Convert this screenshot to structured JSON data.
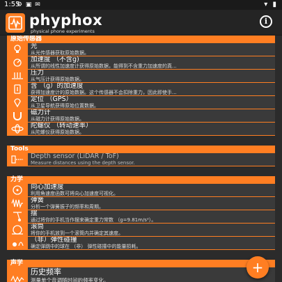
{
  "status": {
    "time": "1:55"
  },
  "header": {
    "app_name": "phyphox",
    "tagline": "physical phone experiments"
  },
  "sections": [
    {
      "title": "原始传感器",
      "items": [
        {
          "title": "光",
          "desc": "从光传感器获取原始数据。",
          "icon": "light-bulb-icon"
        },
        {
          "title": "加速度 （不含g)",
          "desc": "从所谓的线性加速度计获得原始数据，能得到不含重力加速度的真...",
          "icon": "acceleration-icon"
        },
        {
          "title": "压力",
          "desc": "从气压计获得原始数据。",
          "icon": "pressure-icon"
        },
        {
          "title": "含 （g）的加速度",
          "desc": "获得加速度计的原始数据。这个传感器不会扣除重力，因此即使手...",
          "icon": "gravity-acceleration-icon"
        },
        {
          "title": "定位 （GPS）",
          "desc": "从卫星导航获得原始位置数据。",
          "icon": "location-pin-icon"
        },
        {
          "title": "磁力计",
          "desc": "从磁力计获得原始数据。",
          "icon": "magnet-icon"
        },
        {
          "title": "陀螺仪 （转动速率）",
          "desc": "从陀螺仪获得原始数据。",
          "icon": "gyroscope-icon"
        }
      ]
    },
    {
      "title": "Tools",
      "items": [
        {
          "title": "Depth sensor (LiDAR / ToF)",
          "desc": "Measure distances using the depth sensor.",
          "icon": "depth-sensor-icon",
          "disabled": true
        }
      ]
    },
    {
      "title": "力学",
      "items": [
        {
          "title": "向心加速度",
          "desc": "利用角速度函数可将向心加速度可视化。",
          "icon": "centripetal-icon"
        },
        {
          "title": "弹簧",
          "desc": "分析一个弹簧振子的频率和周期。",
          "icon": "spring-icon"
        },
        {
          "title": "摆",
          "desc": "通过将你的手机当作摆来确定重力常数 （g=9.81m/s²）。",
          "icon": "pendulum-icon"
        },
        {
          "title": "滚筒",
          "desc": "将你的手机放到一个滚筒内并确定其速度。",
          "icon": "roller-icon"
        },
        {
          "title": "（非）弹性碰撞",
          "desc": "确定弹跳中的球在 （非） 弹性碰撞中的能量损耗。",
          "icon": "collision-icon"
        }
      ]
    },
    {
      "title": "声学",
      "items": [
        {
          "title": "历史频率",
          "desc": "测量单个音调随时间的频率变化。",
          "icon": "frequency-history-icon"
        }
      ]
    }
  ],
  "fab": {
    "label": "+"
  }
}
